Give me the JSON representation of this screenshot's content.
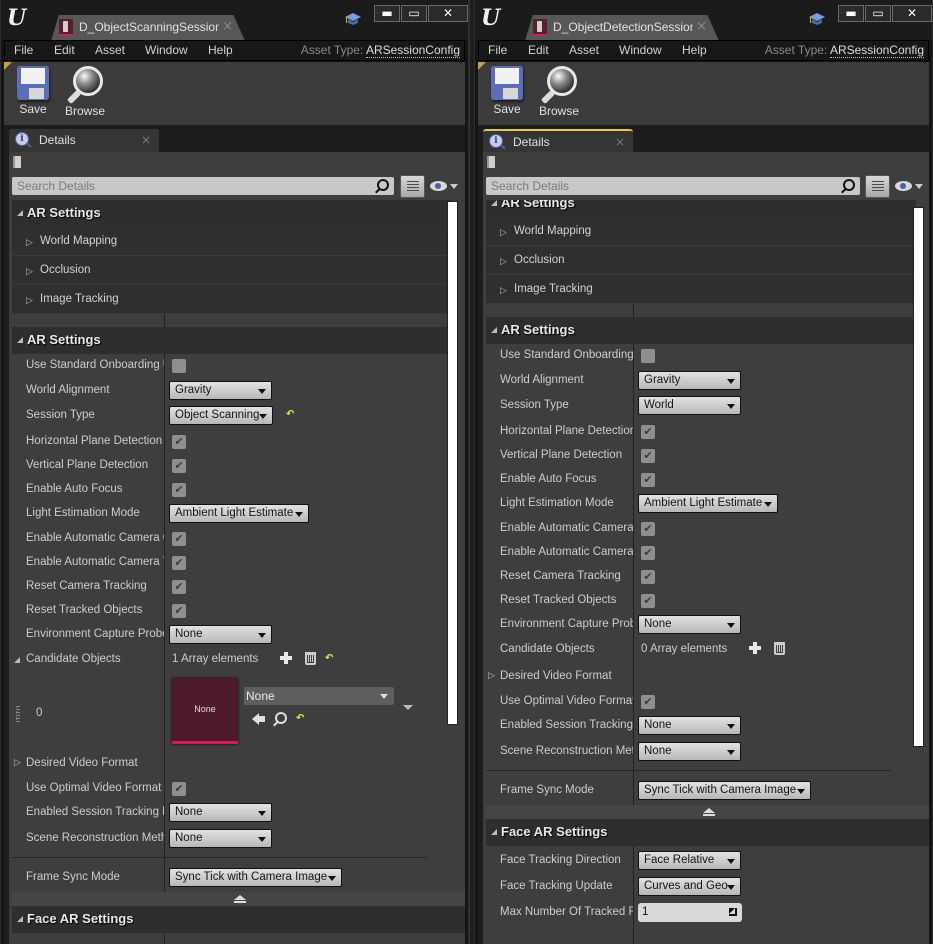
{
  "windows": [
    {
      "tab_title": "D_ObjectScanningSession",
      "menu": [
        "File",
        "Edit",
        "Asset",
        "Window",
        "Help"
      ],
      "asset_type_label": "Asset Type:",
      "asset_type_value": "ARSessionConfig",
      "toolbar": {
        "save": "Save",
        "browse": "Browse"
      },
      "details_tab": "Details",
      "search_placeholder": "Search Details",
      "cat1": {
        "title": "AR Settings",
        "groups": [
          "World Mapping",
          "Occlusion",
          "Image Tracking"
        ]
      },
      "cat2": {
        "title": "AR Settings",
        "rows": [
          {
            "label": "Use Standard Onboarding U",
            "type": "check",
            "checked": false
          },
          {
            "label": "World Alignment",
            "type": "combo",
            "value": "Gravity"
          },
          {
            "label": "Session Type",
            "type": "combo",
            "value": "Object Scanning",
            "reset": true
          },
          {
            "label": "Horizontal Plane Detection",
            "type": "check",
            "checked": true
          },
          {
            "label": "Vertical Plane Detection",
            "type": "check",
            "checked": true
          },
          {
            "label": "Enable Auto Focus",
            "type": "check",
            "checked": true
          },
          {
            "label": "Light Estimation Mode",
            "type": "combo",
            "value": "Ambient Light Estimate"
          },
          {
            "label": "Enable Automatic Camera O",
            "type": "check",
            "checked": true
          },
          {
            "label": "Enable Automatic Camera T",
            "type": "check",
            "checked": true
          },
          {
            "label": "Reset Camera Tracking",
            "type": "check",
            "checked": true
          },
          {
            "label": "Reset Tracked Objects",
            "type": "check",
            "checked": true
          },
          {
            "label": "Environment Capture Probe",
            "type": "combo",
            "value": "None"
          },
          {
            "label": "Candidate Objects",
            "type": "array",
            "value": "1 Array elements",
            "reset": true
          },
          {
            "label": "0",
            "type": "asset",
            "thumb": "None",
            "value": "None"
          },
          {
            "label": "Desired Video Format",
            "type": "group"
          },
          {
            "label": "Use Optimal Video Format",
            "type": "check",
            "checked": true
          },
          {
            "label": "Enabled Session Tracking F",
            "type": "combo",
            "value": "None"
          },
          {
            "label": "Scene Reconstruction Meth",
            "type": "combo",
            "value": "None"
          }
        ],
        "frame_sync": {
          "label": "Frame Sync Mode",
          "value": "Sync Tick with Camera Image"
        }
      },
      "cat3": {
        "title": "Face AR Settings"
      }
    },
    {
      "tab_title": "D_ObjectDetectionSession",
      "menu": [
        "File",
        "Edit",
        "Asset",
        "Window",
        "Help"
      ],
      "asset_type_label": "Asset Type:",
      "asset_type_value": "ARSessionConfig",
      "toolbar": {
        "save": "Save",
        "browse": "Browse"
      },
      "details_tab": "Details",
      "search_placeholder": "Search Details",
      "cat1": {
        "title": "AR Settings",
        "groups": [
          "World Mapping",
          "Occlusion",
          "Image Tracking"
        ]
      },
      "cat2": {
        "title": "AR Settings",
        "rows": [
          {
            "label": "Use Standard Onboarding U",
            "type": "check",
            "checked": false
          },
          {
            "label": "World Alignment",
            "type": "combo",
            "value": "Gravity"
          },
          {
            "label": "Session Type",
            "type": "combo",
            "value": "World"
          },
          {
            "label": "Horizontal Plane Detection",
            "type": "check",
            "checked": true
          },
          {
            "label": "Vertical Plane Detection",
            "type": "check",
            "checked": true
          },
          {
            "label": "Enable Auto Focus",
            "type": "check",
            "checked": true
          },
          {
            "label": "Light Estimation Mode",
            "type": "combo",
            "value": "Ambient Light Estimate"
          },
          {
            "label": "Enable Automatic Camera O",
            "type": "check",
            "checked": true
          },
          {
            "label": "Enable Automatic Camera T",
            "type": "check",
            "checked": true
          },
          {
            "label": "Reset Camera Tracking",
            "type": "check",
            "checked": true
          },
          {
            "label": "Reset Tracked Objects",
            "type": "check",
            "checked": true
          },
          {
            "label": "Environment Capture Probe",
            "type": "combo",
            "value": "None"
          },
          {
            "label": "Candidate Objects",
            "type": "array",
            "value": "0 Array elements"
          },
          {
            "label": "Desired Video Format",
            "type": "group"
          },
          {
            "label": "Use Optimal Video Format",
            "type": "check",
            "checked": true
          },
          {
            "label": "Enabled Session Tracking F",
            "type": "combo",
            "value": "None"
          },
          {
            "label": "Scene Reconstruction Meth",
            "type": "combo",
            "value": "None"
          }
        ],
        "frame_sync": {
          "label": "Frame Sync Mode",
          "value": "Sync Tick with Camera Image"
        }
      },
      "cat3": {
        "title": "Face AR Settings",
        "rows": [
          {
            "label": "Face Tracking Direction",
            "type": "combo",
            "value": "Face Relative"
          },
          {
            "label": "Face Tracking Update",
            "type": "combo",
            "value": "Curves and Geo"
          },
          {
            "label": "Max Number Of Tracked Fa",
            "type": "number",
            "value": "1"
          }
        ]
      }
    }
  ],
  "icons": {
    "close_glyph": "×",
    "check_glyph": "✔",
    "reset_glyph": "↶",
    "expand_glyph": "▷",
    "minimize_glyph": "▬",
    "maximize_glyph": "▭",
    "window_close_glyph": "✕",
    "info_glyph": "i",
    "ue_logo": "U"
  }
}
